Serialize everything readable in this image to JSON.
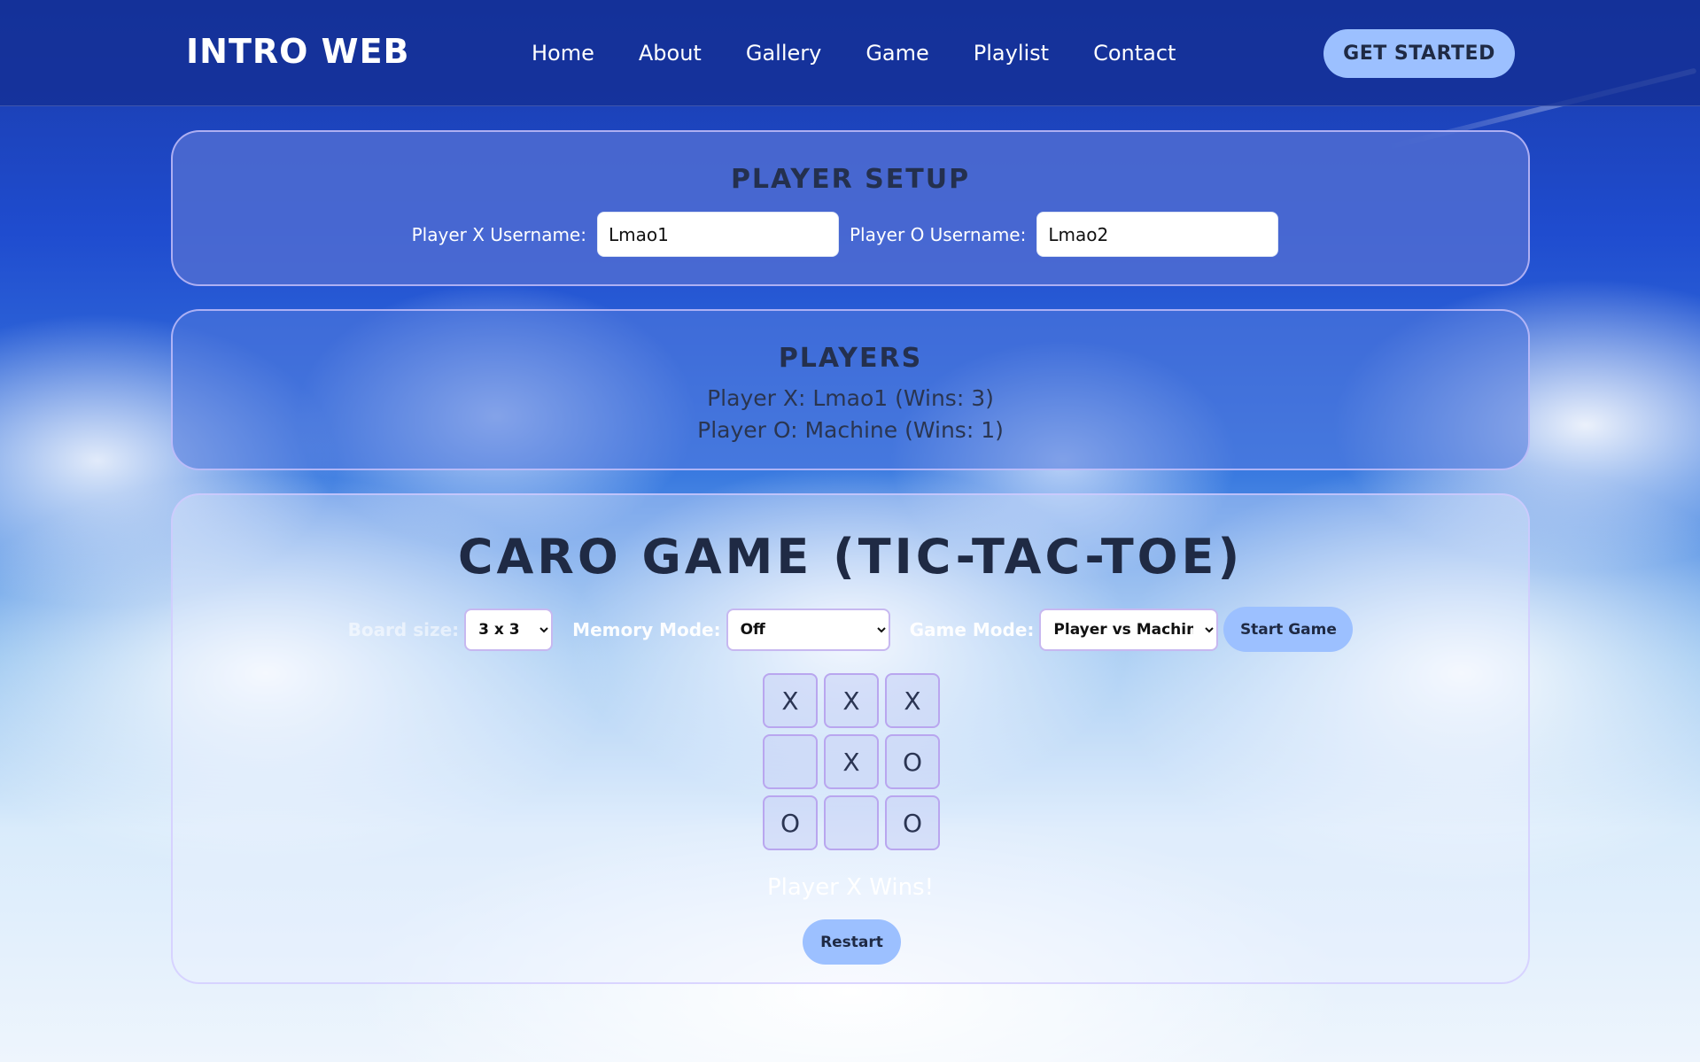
{
  "nav": {
    "logo": "INTRO WEB",
    "links": [
      "Home",
      "About",
      "Gallery",
      "Game",
      "Playlist",
      "Contact"
    ],
    "cta_label": "GET STARTED"
  },
  "setup": {
    "title": "PLAYER SETUP",
    "player_x_label": "Player X Username:",
    "player_x_value": "Lmao1",
    "player_o_label": "Player O Username:",
    "player_o_value": "Lmao2"
  },
  "players": {
    "title": "PLAYERS",
    "player_x_line": "Player X: Lmao1 (Wins: 3)",
    "player_o_line": "Player O: Machine (Wins: 1)"
  },
  "game": {
    "title": "CARO GAME (TIC-TAC-TOE)",
    "board_size_label": "Board size:",
    "board_size_value": "3 x 3",
    "memory_label": "Memory Mode:",
    "memory_value": "Off",
    "mode_label": "Game Mode:",
    "mode_value": "Player vs Machine",
    "start_label": "Start Game",
    "cells": [
      "X",
      "X",
      "X",
      "",
      "X",
      "O",
      "O",
      "",
      "O"
    ],
    "status": "Player X Wins!",
    "restart_label": "Restart"
  },
  "colors": {
    "nav_bg": "#14309a",
    "accent_button": "#9cc0ff",
    "panel_border": "#c7b8f0",
    "title_text": "#1f2a44"
  }
}
